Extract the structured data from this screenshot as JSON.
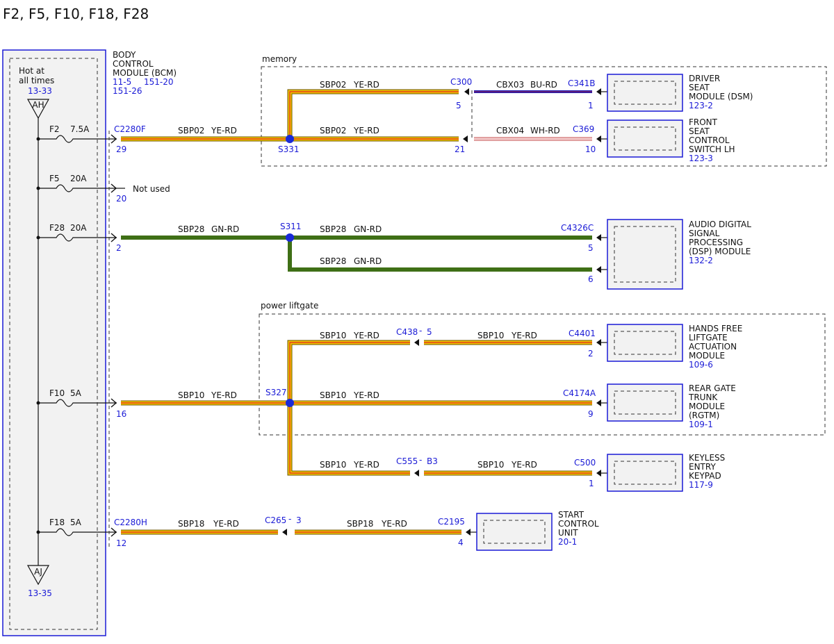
{
  "page_title": "F2, F5, F10, F18, F28",
  "bcm": {
    "name_lines": [
      "BODY",
      "CONTROL",
      "MODULE (BCM)"
    ],
    "ref1": "11-5",
    "ref2": "151-20",
    "ref3": "151-26",
    "hot_lines": [
      "Hot at",
      "all times"
    ],
    "hot_ref": "13-33",
    "ah_label": "AH",
    "aj_label": "AJ",
    "aj_ref": "13-35"
  },
  "fuses": {
    "f2": {
      "name": "F2",
      "rating": "7.5A"
    },
    "f5": {
      "name": "F5",
      "rating": "20A"
    },
    "f28": {
      "name": "F28",
      "rating": "20A"
    },
    "f10": {
      "name": "F10",
      "rating": "5A"
    },
    "f18": {
      "name": "F18",
      "rating": "5A"
    }
  },
  "not_used": "Not used",
  "pins": {
    "bcm_c2280f": "C2280F",
    "bcm_f2_pin": "29",
    "bcm_f5_pin": "20",
    "bcm_f28_pin": "2",
    "bcm_f10_pin": "16",
    "bcm_c2280h": "C2280H",
    "bcm_f18_pin": "12"
  },
  "groups": {
    "memory": "memory",
    "power_liftgate": "power liftgate"
  },
  "splices": {
    "s331": "S331",
    "s311": "S311",
    "s327": "S327"
  },
  "wires": {
    "sbp02_ye_rd": {
      "circuit": "SBP02",
      "color": "YE-RD"
    },
    "sbp28_gn_rd": {
      "circuit": "SBP28",
      "color": "GN-RD"
    },
    "sbp10_ye_rd": {
      "circuit": "SBP10",
      "color": "YE-RD"
    },
    "sbp18_ye_rd": {
      "circuit": "SBP18",
      "color": "YE-RD"
    },
    "cbx03_bu_rd": {
      "circuit": "CBX03",
      "color": "BU-RD"
    },
    "cbx04_wh_rd": {
      "circuit": "CBX04",
      "color": "WH-RD"
    }
  },
  "connectors": {
    "c300": "C300",
    "c300_pin5": "5",
    "c300_pin21": "21",
    "c341b": "C341B",
    "c341b_pin": "1",
    "c369": "C369",
    "c369_pin": "10",
    "c4326c": "C4326C",
    "c4326c_pin5": "5",
    "c4326c_pin6": "6",
    "c438": "C438",
    "c438_pin": "5",
    "c4401": "C4401",
    "c4401_pin": "2",
    "c4174a": "C4174A",
    "c4174a_pin": "9",
    "c555": "C555",
    "c555_pin": "B3",
    "c500": "C500",
    "c500_pin": "1",
    "c265": "C265",
    "c265_pin": "3",
    "c2195": "C2195",
    "c2195_pin": "4",
    "dash": "-"
  },
  "modules": {
    "dsm": {
      "lines": [
        "DRIVER",
        "SEAT",
        "MODULE (DSM)"
      ],
      "ref": "123-2"
    },
    "front_seat": {
      "lines": [
        "FRONT",
        "SEAT",
        "CONTROL",
        "SWITCH LH"
      ],
      "ref": "123-3"
    },
    "dsp": {
      "lines": [
        "AUDIO DIGITAL",
        "SIGNAL",
        "PROCESSING",
        "(DSP) MODULE"
      ],
      "ref": "132-2"
    },
    "hands_free": {
      "lines": [
        "HANDS FREE",
        "LIFTGATE",
        "ACTUATION",
        "MODULE"
      ],
      "ref": "109-6"
    },
    "rgtm": {
      "lines": [
        "REAR GATE",
        "TRUNK",
        "MODULE",
        "(RGTM)"
      ],
      "ref": "109-1"
    },
    "keypad": {
      "lines": [
        "KEYLESS",
        "ENTRY",
        "KEYPAD"
      ],
      "ref": "117-9"
    },
    "start": {
      "lines": [
        "START",
        "CONTROL",
        "UNIT"
      ],
      "ref": "20-1"
    }
  },
  "colors": {
    "ye_rd_outer": "#6b5600",
    "yellow": "#f2c200",
    "red_stripe": "#e0261e",
    "green": "#3f6f16",
    "blue_wire": "#1c1cb4",
    "blue_text": "#1a1ad6",
    "splice": "#1a2ad8",
    "module_fill": "#f2f2f2",
    "module_border": "#1a1ad6"
  }
}
